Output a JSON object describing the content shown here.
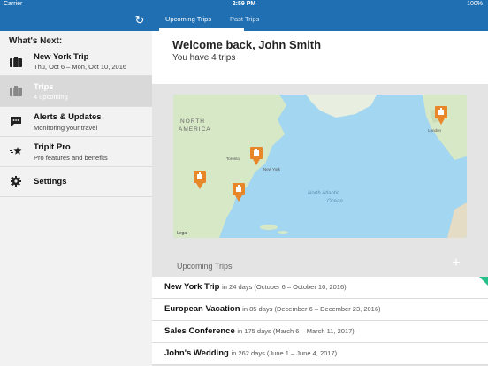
{
  "status_bar": {
    "carrier": "Carrier",
    "time": "2:59 PM",
    "battery": "100%"
  },
  "nav": {
    "tabs": [
      "Upcoming Trips",
      "Past Trips"
    ]
  },
  "sidebar": {
    "heading": "What's Next:",
    "items": [
      {
        "title": "New York Trip",
        "subtitle": "Thu, Oct 6 – Mon, Oct 10, 2016",
        "icon": "suitcase-icon"
      },
      {
        "title": "Trips",
        "subtitle": "4 upcoming",
        "icon": "suitcase-icon"
      },
      {
        "title": "Alerts & Updates",
        "subtitle": "Monitoring your travel",
        "icon": "chat-bubble-icon"
      },
      {
        "title": "TripIt Pro",
        "subtitle": "Pro features and benefits",
        "icon": "star-icon"
      },
      {
        "title": "Settings",
        "subtitle": "",
        "icon": "gear-icon"
      }
    ]
  },
  "main": {
    "welcome": "Welcome back, John Smith",
    "trips_count": "You have 4 trips",
    "map": {
      "labels": {
        "north_america_1": "NORTH",
        "north_america_2": "AMERICA",
        "ocean_1": "North Atlantic",
        "ocean_2": "Ocean",
        "toronto": "Toronto",
        "new_york": "New York",
        "london": "London",
        "legal": "Legal"
      }
    },
    "upcoming_heading": "Upcoming Trips",
    "trips": [
      {
        "name": "New York Trip",
        "info": "in 24 days (October 6 – October 10, 2016)"
      },
      {
        "name": "European Vacation",
        "info": "in 85 days (December 6 – December 23, 2016)"
      },
      {
        "name": "Sales Conference",
        "info": "in 175 days (March 6 – March 11, 2017)"
      },
      {
        "name": "John's Wedding",
        "info": "in 262 days (June 1 – June 4, 2017)"
      }
    ]
  },
  "colors": {
    "nav_blue": "#1f6fb2",
    "pin_orange": "#e8862a",
    "accent_green": "#27c08a"
  }
}
